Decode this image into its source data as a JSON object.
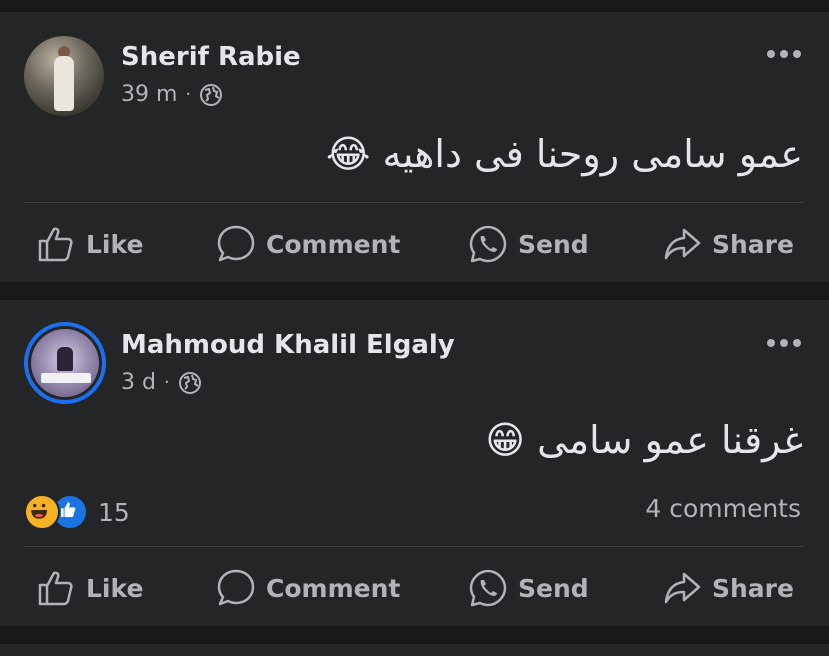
{
  "posts": [
    {
      "author": "Sherif Rabie",
      "time": "39 m",
      "separator": "·",
      "text": "عمو سامى روحنا فى داهيه 😂",
      "actions": {
        "like": "Like",
        "comment": "Comment",
        "send": "Send",
        "share": "Share"
      }
    },
    {
      "author": "Mahmoud Khalil Elgaly",
      "time": "3 d",
      "separator": "·",
      "text": "غرقنا عمو سامى 😁",
      "reactions_count": "15",
      "comments_count": "4 comments",
      "actions": {
        "like": "Like",
        "comment": "Comment",
        "send": "Send",
        "share": "Share"
      }
    }
  ],
  "icons": {
    "privacy": "globe-icon",
    "more": "more-options-icon",
    "like": "thumbs-up-icon",
    "comment": "comment-bubble-icon",
    "send": "whatsapp-icon",
    "share": "share-arrow-icon",
    "reaction_1": "haha-reaction-icon",
    "reaction_2": "like-reaction-icon"
  },
  "colors": {
    "background": "#18191a",
    "card": "#242526",
    "text_primary": "#e4e6eb",
    "text_secondary": "#b0b3b8",
    "accent": "#1d6ff2"
  }
}
